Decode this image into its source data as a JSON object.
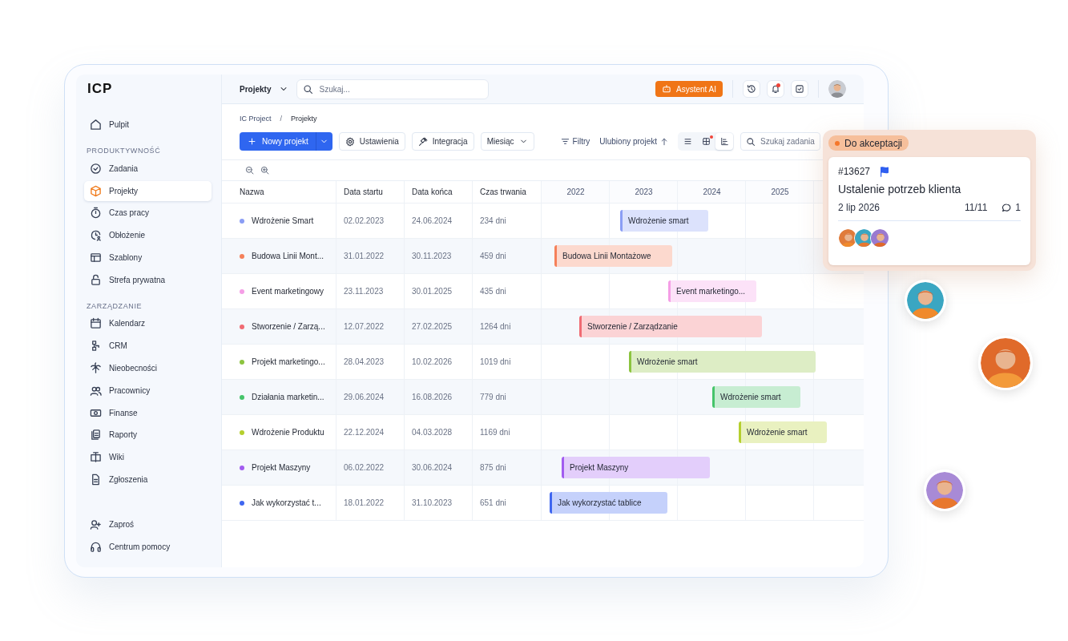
{
  "sidebar": {
    "logo": "ICP",
    "groups": [
      {
        "items": [
          {
            "label": "Pulpit",
            "selected": false
          }
        ]
      },
      {
        "heading": "PRODUKTYWNOŚĆ",
        "items": [
          {
            "label": "Zadania",
            "selected": false
          },
          {
            "label": "Projekty",
            "selected": true
          },
          {
            "label": "Czas pracy",
            "selected": false
          },
          {
            "label": "Obłożenie",
            "selected": false
          },
          {
            "label": "Szablony",
            "selected": false
          },
          {
            "label": "Strefa prywatna",
            "selected": false
          }
        ]
      },
      {
        "heading": "ZARZĄDZANIE",
        "items": [
          {
            "label": "Kalendarz",
            "selected": false
          },
          {
            "label": "CRM",
            "selected": false
          },
          {
            "label": "Nieobecności",
            "selected": false
          },
          {
            "label": "Pracownicy",
            "selected": false
          },
          {
            "label": "Finanse",
            "selected": false
          },
          {
            "label": "Raporty",
            "selected": false
          },
          {
            "label": "Wiki",
            "selected": false
          },
          {
            "label": "Zgłoszenia",
            "selected": false
          }
        ]
      }
    ],
    "footer_items": [
      {
        "label": "Zaproś"
      },
      {
        "label": "Centrum pomocy"
      }
    ]
  },
  "topbar": {
    "section_menu": "Projekty",
    "search": {
      "placeholder": "Szukaj..."
    },
    "assistant_button": "Asystent AI",
    "bell_badge": true
  },
  "breadcrumb": {
    "items": [
      "IC Project",
      "Projekty"
    ],
    "separator": "/"
  },
  "toolbar": {
    "new_button": "Nowy projekt",
    "buttons": [
      "Ustawienia",
      "Integracja"
    ],
    "period_select": "Miesiąc",
    "filter_button": "Filtry",
    "sort_button": "Ulubiony projekt",
    "views": [
      {
        "kind": "list",
        "selected": false,
        "badge": false
      },
      {
        "kind": "board",
        "selected": false,
        "badge": true
      },
      {
        "kind": "gantt",
        "selected": true,
        "badge": false
      }
    ],
    "task_search": {
      "placeholder": "Szukaj zadania"
    }
  },
  "table": {
    "columns": [
      "Nazwa",
      "Data startu",
      "Data końca",
      "Czas trwania"
    ],
    "years": [
      "2022",
      "2023",
      "2024",
      "2025"
    ],
    "rows": [
      {
        "name": "Wdrożenie Smart",
        "color": "#8a9df5",
        "start": "02.02.2023",
        "end": "24.06.2024",
        "duration": "234 dni",
        "bar_label": "Wdrożenie smart"
      },
      {
        "name": "Budowa Linii Mont...",
        "color": "#f5805a",
        "start": "31.01.2022",
        "end": "30.11.2023",
        "duration": "459 dni",
        "bar_label": "Budowa Linii Montażowe"
      },
      {
        "name": "Event marketingowy",
        "color": "#f59ee6",
        "start": "23.11.2023",
        "end": "30.01.2025",
        "duration": "435 dni",
        "bar_label": "Event marketingo..."
      },
      {
        "name": "Stworzenie / Zarzą...",
        "color": "#f06b73",
        "start": "12.07.2022",
        "end": "27.02.2025",
        "duration": "1264 dni",
        "bar_label": "Stworzenie / Zarządzanie"
      },
      {
        "name": "Projekt marketingo...",
        "color": "#8cc43f",
        "start": "28.04.2023",
        "end": "10.02.2026",
        "duration": "1019 dni",
        "bar_label": "Wdrożenie smart"
      },
      {
        "name": "Działania marketin...",
        "color": "#45c46a",
        "start": "29.06.2024",
        "end": "16.08.2026",
        "duration": "779 dni",
        "bar_label": "Wdrożenie smart"
      },
      {
        "name": "Wdrożenie Produktu",
        "color": "#b5cf2e",
        "start": "22.12.2024",
        "end": "04.03.2028",
        "duration": "1169 dni",
        "bar_label": "Wdrożenie smart"
      },
      {
        "name": "Projekt Maszyny",
        "color": "#a25cf0",
        "start": "06.02.2022",
        "end": "30.06.2024",
        "duration": "875 dni",
        "bar_label": "Projekt Maszyny"
      },
      {
        "name": "Jak wykorzystać t...",
        "color": "#3f66f0",
        "start": "18.01.2022",
        "end": "31.10.2023",
        "duration": "651 dni",
        "bar_label": "Jak wykorzystać tablice"
      }
    ]
  },
  "task_card": {
    "status": "Do akceptacji",
    "number": "#13627",
    "flagged": true,
    "title": "Ustalenie potrzeb klienta",
    "date": "2 lip 2026",
    "progress": "11/11",
    "comments": "1"
  }
}
